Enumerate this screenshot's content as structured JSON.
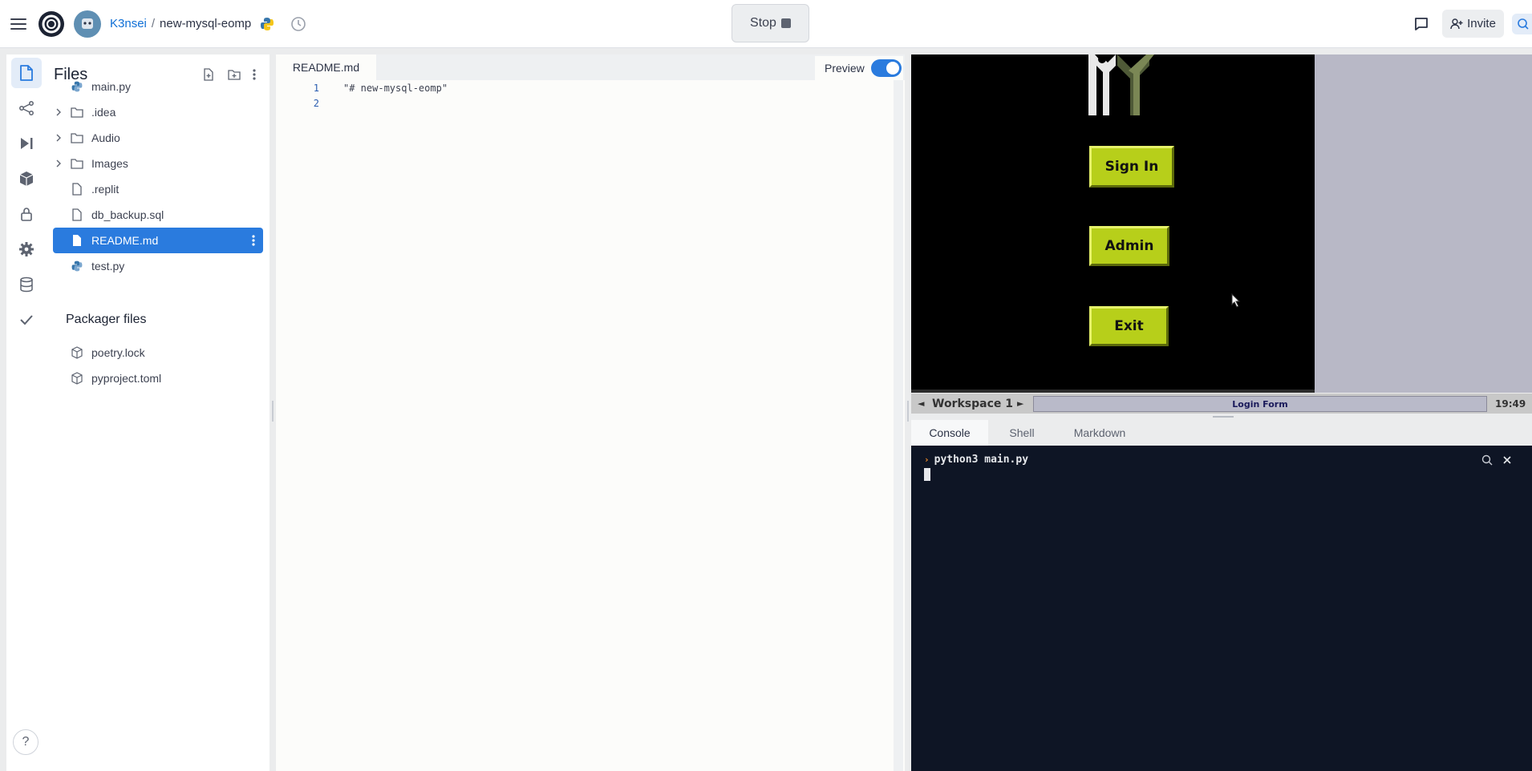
{
  "topbar": {
    "user": "K3nsei",
    "separator": "/",
    "repl_name": "new-mysql-eomp",
    "stop_label": "Stop",
    "invite_label": "Invite"
  },
  "files_panel": {
    "title": "Files",
    "items": [
      {
        "label": "main.py",
        "type": "python"
      },
      {
        "label": ".idea",
        "type": "folder"
      },
      {
        "label": "Audio",
        "type": "folder"
      },
      {
        "label": "Images",
        "type": "folder"
      },
      {
        "label": ".replit",
        "type": "file"
      },
      {
        "label": "db_backup.sql",
        "type": "file"
      },
      {
        "label": "README.md",
        "type": "file",
        "selected": true
      },
      {
        "label": "test.py",
        "type": "python"
      }
    ],
    "packager_title": "Packager files",
    "packager_items": [
      {
        "label": "poetry.lock",
        "type": "package"
      },
      {
        "label": "pyproject.toml",
        "type": "package"
      }
    ]
  },
  "editor": {
    "tab_label": "README.md",
    "preview_label": "Preview",
    "preview_enabled": true,
    "lines": [
      {
        "num": "1",
        "text": "\"# new-mysql-eomp\""
      },
      {
        "num": "2",
        "text": ""
      }
    ]
  },
  "vnc": {
    "buttons": [
      "Sign In",
      "Admin",
      "Exit"
    ],
    "workspace_label": "Workspace 1",
    "task_label": "Login Form",
    "clock": "19:49"
  },
  "console": {
    "tabs": [
      "Console",
      "Shell",
      "Markdown"
    ],
    "command": "python3 main.py"
  },
  "colors": {
    "accent": "#2a7bde",
    "console_bg": "#0e1525",
    "button_yellow": "#b7cf1a"
  }
}
